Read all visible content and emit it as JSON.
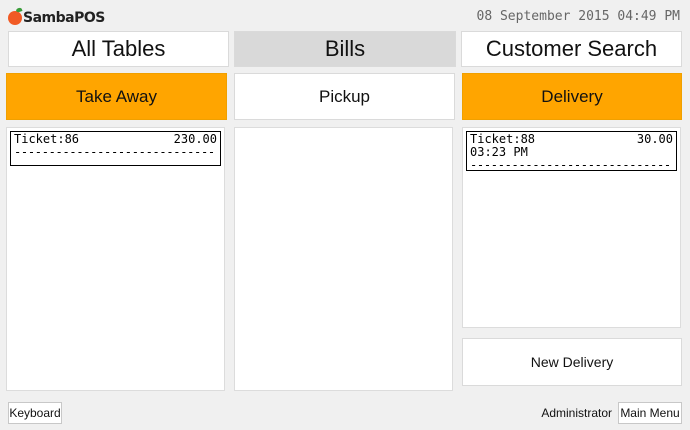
{
  "app": {
    "logo_text": "SambaPOS",
    "datetime": "08 September 2015 04:49 PM"
  },
  "tabs": [
    {
      "label": "All Tables"
    },
    {
      "label": "Bills"
    },
    {
      "label": "Customer Search"
    }
  ],
  "categories": [
    {
      "label": "Take Away"
    },
    {
      "label": "Pickup"
    },
    {
      "label": "Delivery"
    }
  ],
  "colors": {
    "accent_orange": "#ffa500",
    "active_tab": "#d9d9d9"
  },
  "take_away_tickets": [
    {
      "title": "Ticket:86",
      "amount": "230.00",
      "time": "",
      "divider": "-----------------------------"
    }
  ],
  "delivery_tickets": [
    {
      "title": "Ticket:88",
      "amount": "30.00",
      "time": "03:23 PM",
      "divider": "-----------------------------"
    }
  ],
  "new_delivery_label": "New Delivery",
  "footer": {
    "keyboard_label": "Keyboard",
    "user_name": "Administrator",
    "main_menu_label": "Main Menu"
  }
}
